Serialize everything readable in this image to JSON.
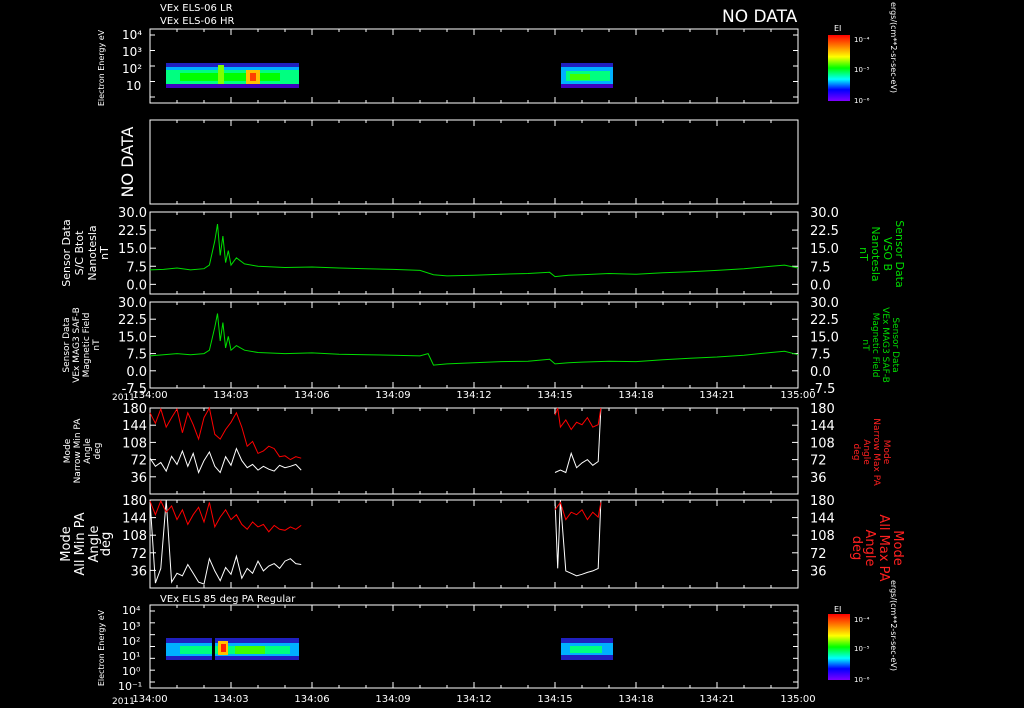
{
  "header": {
    "line1": "VEx ELS-06 LR",
    "line2": "VEx ELS-06 HR",
    "no_data": "NO DATA"
  },
  "colorbar": {
    "title": "EI",
    "ticks": [
      "10⁻⁴",
      "10⁻⁵",
      "10⁻⁶"
    ],
    "unit": "ergs/(cm**2-sr-sec-eV)",
    "colors": [
      "#ff0000",
      "#ff8000",
      "#ffff00",
      "#00ff00",
      "#00ffff",
      "#0000ff",
      "#8000ff"
    ]
  },
  "colorbar2": {
    "title": "EI",
    "ticks": [
      "10⁻⁴",
      "10⁻⁵",
      "10⁻⁶"
    ],
    "unit": "ergs/(cm**2-sr-sec-eV)"
  },
  "panel2": {
    "no_data": "NO DATA"
  },
  "bottom_title": "VEx ELS 85 deg PA Regular",
  "time_axis": {
    "year": "2011",
    "ticks": [
      "134:00",
      "134:03",
      "134:06",
      "134:09",
      "134:12",
      "134:15",
      "134:18",
      "134:21",
      "135:00"
    ]
  },
  "chart_data": [
    {
      "type": "heatmap",
      "title": "VEx ELS-06 LR / VEx ELS-06 HR",
      "ylabel": "Electron Energy eV",
      "yscale": "log",
      "yticks": [
        "10",
        "10²",
        "10³",
        "10⁴"
      ],
      "data_intervals_min": [
        [
          0.0,
          5.6
        ],
        [
          15.0,
          16.7
        ]
      ],
      "xlim_min": [
        0,
        24
      ]
    },
    {
      "type": "line",
      "label": "NO DATA",
      "series": []
    },
    {
      "type": "line",
      "ylabel_left": [
        "Sensor Data",
        "S/C Btot",
        "Nanotesla",
        "nT"
      ],
      "ylabel_right": [
        "Sensor Data",
        "VSO B",
        "Nanotesla",
        "nT"
      ],
      "yticks": [
        "30.0",
        "22.5",
        "15.0",
        "7.5",
        "0.0"
      ],
      "ylim": [
        -4,
        30
      ],
      "line_color": "#00dd00",
      "series": [
        {
          "x": [
            0,
            0.5,
            1,
            1.5,
            2,
            2.2,
            2.4,
            2.5,
            2.6,
            2.7,
            2.8,
            2.9,
            3.0,
            3.2,
            3.5,
            4,
            5,
            6,
            7,
            8,
            9,
            10,
            10.5,
            11,
            12,
            13,
            14,
            14.8,
            15,
            15.5,
            16,
            17,
            18,
            19,
            20,
            21,
            22,
            23,
            23.5,
            24
          ],
          "y": [
            6.0,
            6.2,
            6.8,
            6.0,
            6.5,
            8.0,
            18.0,
            25.0,
            12.0,
            20.0,
            9.0,
            14.0,
            8.0,
            11.0,
            8.5,
            7.5,
            7.0,
            7.2,
            6.8,
            6.5,
            6.2,
            5.8,
            4.0,
            3.5,
            3.8,
            4.2,
            4.5,
            5.0,
            3.2,
            3.8,
            4.0,
            4.5,
            4.2,
            4.8,
            5.2,
            5.8,
            6.5,
            7.5,
            8.0,
            6.8
          ]
        }
      ]
    },
    {
      "type": "line",
      "ylabel_left": [
        "Sensor Data",
        "VEx MAG3 SAF-B",
        "Magnetic Field",
        "nT"
      ],
      "ylabel_right": [
        "Sensor Data",
        "VEx MAG3 SAF-B",
        "Magnetic Field",
        "nT"
      ],
      "yticks": [
        "30.0",
        "22.5",
        "15.0",
        "7.5",
        "0.0",
        "-7.5"
      ],
      "ylim": [
        -7.5,
        30
      ],
      "line_color": "#00dd00",
      "series": [
        {
          "x": [
            0,
            0.5,
            1,
            1.5,
            2,
            2.2,
            2.4,
            2.5,
            2.6,
            2.7,
            2.8,
            2.9,
            3.0,
            3.2,
            3.5,
            4,
            5,
            6,
            7,
            8,
            9,
            10,
            10.3,
            10.5,
            11,
            12,
            13,
            14,
            14.8,
            15,
            15.5,
            16,
            17,
            18,
            19,
            20,
            21,
            22,
            23,
            23.5,
            24
          ],
          "y": [
            6.5,
            7.0,
            7.5,
            7.0,
            7.5,
            9.0,
            19.0,
            25.0,
            13.0,
            21.0,
            10.0,
            15.0,
            9.0,
            11.0,
            9.0,
            8.0,
            7.5,
            7.8,
            7.2,
            7.0,
            6.8,
            6.5,
            7.5,
            2.5,
            3.0,
            3.5,
            4.0,
            4.2,
            5.0,
            3.0,
            3.5,
            3.8,
            4.2,
            4.0,
            4.8,
            5.5,
            6.0,
            6.8,
            8.0,
            8.5,
            7.0
          ]
        }
      ]
    },
    {
      "type": "line",
      "ylabel_left": [
        "Mode",
        "Narrow Min PA",
        "Angle",
        "deg"
      ],
      "ylabel_right": [
        "Mode",
        "Narrow Max PA",
        "Angle",
        "deg"
      ],
      "yticks": [
        "180",
        "144",
        "108",
        "72",
        "36"
      ],
      "ylim": [
        0,
        180
      ],
      "series": [
        {
          "name": "Narrow Min PA",
          "color": "#ffffff",
          "x": [
            0.0,
            0.2,
            0.4,
            0.6,
            0.8,
            1.0,
            1.2,
            1.4,
            1.6,
            1.8,
            2.0,
            2.2,
            2.4,
            2.6,
            2.8,
            3.0,
            3.2,
            3.4,
            3.6,
            3.8,
            4.0,
            4.2,
            4.4,
            4.6,
            4.8,
            5.0,
            5.2,
            5.4,
            5.6
          ],
          "y": [
            75,
            58,
            66,
            48,
            79,
            62,
            90,
            58,
            85,
            45,
            70,
            88,
            58,
            45,
            78,
            60,
            95,
            70,
            55,
            62,
            50,
            58,
            52,
            48,
            60,
            55,
            58,
            62,
            50
          ]
        },
        {
          "name": "Narrow Max PA",
          "color": "#ff0000",
          "x": [
            0.0,
            0.2,
            0.4,
            0.6,
            0.8,
            1.0,
            1.2,
            1.4,
            1.6,
            1.8,
            2.0,
            2.2,
            2.4,
            2.6,
            2.8,
            3.0,
            3.2,
            3.4,
            3.6,
            3.8,
            4.0,
            4.2,
            4.4,
            4.6,
            4.8,
            5.0,
            5.2,
            5.4,
            5.6
          ],
          "y": [
            170,
            148,
            178,
            140,
            160,
            178,
            128,
            170,
            145,
            115,
            160,
            180,
            125,
            115,
            135,
            150,
            170,
            140,
            100,
            110,
            85,
            90,
            100,
            95,
            78,
            80,
            72,
            78,
            75
          ]
        },
        {
          "name": "Narrow Min PA",
          "color": "#ffffff",
          "x": [
            15.0,
            15.2,
            15.4,
            15.6,
            15.8,
            16.0,
            16.2,
            16.4,
            16.6,
            16.7
          ],
          "y": [
            45,
            50,
            45,
            85,
            55,
            65,
            72,
            60,
            68,
            180
          ]
        },
        {
          "name": "Narrow Max PA",
          "color": "#ff0000",
          "x": [
            15.0,
            15.1,
            15.2,
            15.4,
            15.6,
            15.8,
            16.0,
            16.2,
            16.4,
            16.6,
            16.7
          ],
          "y": [
            165,
            180,
            140,
            155,
            135,
            150,
            145,
            160,
            140,
            145,
            180
          ]
        }
      ]
    },
    {
      "type": "line",
      "ylabel_left": [
        "Mode",
        "All Min PA",
        "Angle",
        "deg"
      ],
      "ylabel_right": [
        "Mode",
        "All Max PA",
        "Angle",
        "deg"
      ],
      "yticks": [
        "180",
        "144",
        "108",
        "72",
        "36"
      ],
      "ylim": [
        0,
        180
      ],
      "series": [
        {
          "name": "All Min PA",
          "color": "#ffffff",
          "x": [
            0.0,
            0.2,
            0.4,
            0.6,
            0.8,
            1.0,
            1.2,
            1.4,
            1.6,
            1.8,
            2.0,
            2.2,
            2.4,
            2.6,
            2.8,
            3.0,
            3.2,
            3.4,
            3.6,
            3.8,
            4.0,
            4.2,
            4.4,
            4.6,
            4.8,
            5.0,
            5.2,
            5.4,
            5.6
          ],
          "y": [
            180,
            10,
            40,
            180,
            12,
            30,
            25,
            48,
            30,
            12,
            8,
            60,
            35,
            15,
            42,
            28,
            65,
            20,
            40,
            30,
            55,
            35,
            45,
            50,
            40,
            55,
            60,
            50,
            48
          ]
        },
        {
          "name": "All Max PA",
          "color": "#ff0000",
          "x": [
            0.0,
            0.2,
            0.4,
            0.6,
            0.8,
            1.0,
            1.2,
            1.4,
            1.6,
            1.8,
            2.0,
            2.2,
            2.4,
            2.6,
            2.8,
            3.0,
            3.2,
            3.4,
            3.6,
            3.8,
            4.0,
            4.2,
            4.4,
            4.6,
            4.8,
            5.0,
            5.2,
            5.4,
            5.6
          ],
          "y": [
            178,
            150,
            178,
            155,
            168,
            140,
            160,
            130,
            150,
            165,
            135,
            175,
            125,
            145,
            160,
            140,
            150,
            130,
            120,
            135,
            125,
            130,
            115,
            128,
            120,
            118,
            125,
            120,
            128
          ]
        },
        {
          "name": "All Min PA",
          "color": "#ffffff",
          "x": [
            15.0,
            15.1,
            15.2,
            15.4,
            15.6,
            15.8,
            16.0,
            16.2,
            16.4,
            16.6,
            16.7
          ],
          "y": [
            180,
            40,
            180,
            35,
            30,
            25,
            28,
            32,
            35,
            40,
            180
          ]
        },
        {
          "name": "All Max PA",
          "color": "#ff0000",
          "x": [
            15.0,
            15.2,
            15.4,
            15.6,
            15.8,
            16.0,
            16.2,
            16.4,
            16.6,
            16.7
          ],
          "y": [
            160,
            175,
            140,
            155,
            150,
            160,
            140,
            155,
            145,
            175
          ]
        }
      ]
    },
    {
      "type": "heatmap",
      "title": "VEx ELS 85 deg PA Regular",
      "ylabel": "Electron Energy eV",
      "yscale": "log",
      "yticks": [
        "10⁻¹",
        "10⁰",
        "10¹",
        "10²",
        "10³",
        "10⁴"
      ],
      "data_intervals_min": [
        [
          0.0,
          5.6
        ],
        [
          15.0,
          16.7
        ]
      ],
      "xlim_min": [
        0,
        24
      ]
    }
  ]
}
